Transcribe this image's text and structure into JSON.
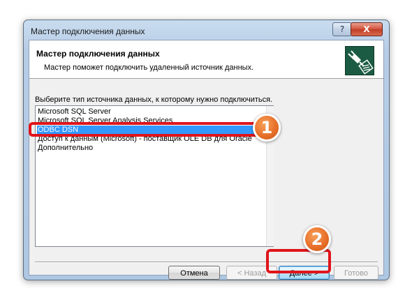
{
  "window": {
    "title": "Мастер подключения данных",
    "help_label": "?",
    "close_label": "X"
  },
  "header": {
    "title": "Мастер подключения данных",
    "subtitle": "Мастер поможет подключить удаленный источник данных.",
    "icon": "plug-connector-icon"
  },
  "body": {
    "prompt": "Выберите тип источника данных, к которому нужно подключиться.",
    "data_sources": [
      "Microsoft SQL Server",
      "Microsoft SQL Server Analysis Services",
      "ODBC DSN",
      "Доступ к данным (Microsoft) - поставщик OLE DB для Oracle",
      "Дополнительно"
    ],
    "selected": "ODBC DSN"
  },
  "buttons": {
    "cancel": "Отмена",
    "back": "< Назад",
    "next": "Далее >",
    "finish": "Готово"
  },
  "callouts": {
    "step1": "1",
    "step2": "2"
  },
  "colors": {
    "selection": "#3399ff",
    "callout_border": "#e0151b",
    "badge_orange": "#e8702a",
    "frame_blue": "#b7cde6"
  }
}
